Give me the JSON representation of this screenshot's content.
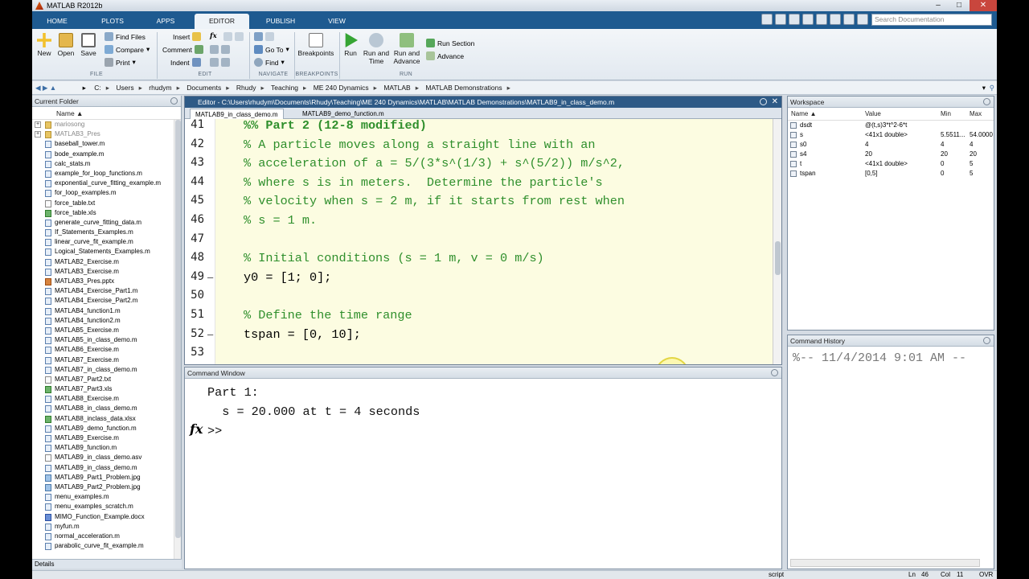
{
  "window": {
    "title": "MATLAB R2012b",
    "controls": [
      "–",
      "□",
      "✕"
    ]
  },
  "ribbon_tabs": [
    "HOME",
    "PLOTS",
    "APPS",
    "EDITOR",
    "PUBLISH",
    "VIEW"
  ],
  "active_tab": "EDITOR",
  "search": {
    "placeholder": "Search Documentation"
  },
  "ribbon": {
    "file": {
      "new": "New",
      "open": "Open",
      "save": "Save",
      "find_files": "Find Files",
      "compare": "Compare",
      "print": "Print",
      "label": "FILE"
    },
    "edit": {
      "insert": "Insert",
      "comment": "Comment",
      "indent": "Indent",
      "fx": "fx",
      "label": "EDIT"
    },
    "navigate": {
      "go_to": "Go To",
      "find": "Find",
      "label": "NAVIGATE"
    },
    "breakpoints": {
      "button": "Breakpoints",
      "label": "BREAKPOINTS"
    },
    "run": {
      "run": "Run",
      "run_and_time": "Run and Time",
      "run_and_advance": "Run and Advance",
      "run_section": "Run Section",
      "advance": "Advance",
      "label": "RUN"
    }
  },
  "address": [
    "C:",
    "Users",
    "rhudym",
    "Documents",
    "Rhudy",
    "Teaching",
    "ME 240 Dynamics",
    "MATLAB",
    "MATLAB Demonstrations"
  ],
  "current_folder": {
    "title": "Current Folder",
    "column": "Name ▲",
    "files": [
      {
        "name": "mariosong",
        "type": "folder",
        "expand": "+",
        "dim": true
      },
      {
        "name": "MATLAB3_Pres",
        "type": "folder",
        "expand": "+",
        "dim": true
      },
      {
        "name": "baseball_tower.m",
        "type": "mfile"
      },
      {
        "name": "bode_example.m",
        "type": "mfile"
      },
      {
        "name": "calc_stats.m",
        "type": "mfile"
      },
      {
        "name": "example_for_loop_functions.m",
        "type": "mfile"
      },
      {
        "name": "exponential_curve_fitting_example.m",
        "type": "mfile"
      },
      {
        "name": "for_loop_examples.m",
        "type": "mfile"
      },
      {
        "name": "force_table.txt",
        "type": "txt"
      },
      {
        "name": "force_table.xls",
        "type": "xls"
      },
      {
        "name": "generate_curve_fitting_data.m",
        "type": "mfile"
      },
      {
        "name": "If_Statements_Examples.m",
        "type": "mfile"
      },
      {
        "name": "linear_curve_fit_example.m",
        "type": "mfile"
      },
      {
        "name": "Logical_Statements_Examples.m",
        "type": "mfile"
      },
      {
        "name": "MATLAB2_Exercise.m",
        "type": "mfile"
      },
      {
        "name": "MATLAB3_Exercise.m",
        "type": "mfile"
      },
      {
        "name": "MATLAB3_Pres.pptx",
        "type": "ppt"
      },
      {
        "name": "MATLAB4_Exercise_Part1.m",
        "type": "mfile"
      },
      {
        "name": "MATLAB4_Exercise_Part2.m",
        "type": "mfile"
      },
      {
        "name": "MATLAB4_function1.m",
        "type": "mfile"
      },
      {
        "name": "MATLAB4_function2.m",
        "type": "mfile"
      },
      {
        "name": "MATLAB5_Exercise.m",
        "type": "mfile"
      },
      {
        "name": "MATLAB5_in_class_demo.m",
        "type": "mfile"
      },
      {
        "name": "MATLAB6_Exercise.m",
        "type": "mfile"
      },
      {
        "name": "MATLAB7_Exercise.m",
        "type": "mfile"
      },
      {
        "name": "MATLAB7_in_class_demo.m",
        "type": "mfile"
      },
      {
        "name": "MATLAB7_Part2.txt",
        "type": "txt"
      },
      {
        "name": "MATLAB7_Part3.xls",
        "type": "xls"
      },
      {
        "name": "MATLAB8_Exercise.m",
        "type": "mfile"
      },
      {
        "name": "MATLAB8_in_class_demo.m",
        "type": "mfile"
      },
      {
        "name": "MATLAB8_inclass_data.xlsx",
        "type": "xls"
      },
      {
        "name": "MATLAB9_demo_function.m",
        "type": "mfile"
      },
      {
        "name": "MATLAB9_Exercise.m",
        "type": "mfile"
      },
      {
        "name": "MATLAB9_function.m",
        "type": "mfile"
      },
      {
        "name": "MATLAB9_in_class_demo.asv",
        "type": "txt"
      },
      {
        "name": "MATLAB9_in_class_demo.m",
        "type": "mfile"
      },
      {
        "name": "MATLAB9_Part1_Problem.jpg",
        "type": "img"
      },
      {
        "name": "MATLAB9_Part2_Problem.jpg",
        "type": "img"
      },
      {
        "name": "menu_examples.m",
        "type": "mfile"
      },
      {
        "name": "menu_examples_scratch.m",
        "type": "mfile"
      },
      {
        "name": "MIMO_Function_Example.docx",
        "type": "doc"
      },
      {
        "name": "myfun.m",
        "type": "mfile"
      },
      {
        "name": "normal_acceleration.m",
        "type": "mfile"
      },
      {
        "name": "parabolic_curve_fit_example.m",
        "type": "mfile"
      }
    ],
    "details_label": "Details"
  },
  "editor": {
    "title": "Editor - C:\\Users\\rhudym\\Documents\\Rhudy\\Teaching\\ME 240 Dynamics\\MATLAB\\MATLAB Demonstrations\\MATLAB9_in_class_demo.m",
    "tabs": [
      "MATLAB9_in_class_demo.m",
      "MATLAB9_demo_function.m"
    ],
    "lines": [
      {
        "n": "41",
        "text": "%% Part 2 (12-8 modified)",
        "style": "cb",
        "dash": ""
      },
      {
        "n": "42",
        "text": "% A particle moves along a straight line with an",
        "style": "c",
        "dash": ""
      },
      {
        "n": "43",
        "text": "% acceleration of a = 5/(3*s^(1/3) + s^(5/2)) m/s^2,",
        "style": "c",
        "dash": ""
      },
      {
        "n": "44",
        "text": "% where s is in meters.  Determine the particle's",
        "style": "c",
        "dash": ""
      },
      {
        "n": "45",
        "text": "% velocity when s = 2 m, if it starts from rest when",
        "style": "c",
        "dash": ""
      },
      {
        "n": "46",
        "text": "% s = 1 m.",
        "style": "c",
        "dash": ""
      },
      {
        "n": "47",
        "text": "",
        "style": "k",
        "dash": ""
      },
      {
        "n": "48",
        "text": "% Initial conditions (s = 1 m, v = 0 m/s)",
        "style": "c",
        "dash": ""
      },
      {
        "n": "49",
        "text": "y0 = [1; 0];",
        "style": "k",
        "dash": "—"
      },
      {
        "n": "50",
        "text": "",
        "style": "k",
        "dash": ""
      },
      {
        "n": "51",
        "text": "% Define the time range",
        "style": "c",
        "dash": ""
      },
      {
        "n": "52",
        "text": "tspan = [0, 10];",
        "style": "k",
        "dash": "—"
      },
      {
        "n": "53",
        "text": "",
        "style": "k",
        "dash": ""
      }
    ]
  },
  "command_window": {
    "title": "Command Window",
    "lines": [
      "Part 1:",
      "  s = 20.000 at t = 4 seconds"
    ],
    "prompt": ">>",
    "fx": "fx"
  },
  "workspace": {
    "title": "Workspace",
    "columns": [
      "Name ▲",
      "Value",
      "Min",
      "Max"
    ],
    "vars": [
      {
        "name": "dsdt",
        "value": "@(t,s)3*t^2-6*t",
        "min": "",
        "max": ""
      },
      {
        "name": "s",
        "value": "<41x1 double>",
        "min": "5.5511...",
        "max": "54.0000"
      },
      {
        "name": "s0",
        "value": "4",
        "min": "4",
        "max": "4"
      },
      {
        "name": "s4",
        "value": "20",
        "min": "20",
        "max": "20"
      },
      {
        "name": "t",
        "value": "<41x1 double>",
        "min": "0",
        "max": "5"
      },
      {
        "name": "tspan",
        "value": "[0,5]",
        "min": "0",
        "max": "5"
      }
    ]
  },
  "history": {
    "title": "Command History",
    "entry": "%-- 11/4/2014 9:01 AM --"
  },
  "status": {
    "mode": "script",
    "ln_label": "Ln",
    "ln": "46",
    "col_label": "Col",
    "col": "11",
    "ovr": "OVR"
  }
}
